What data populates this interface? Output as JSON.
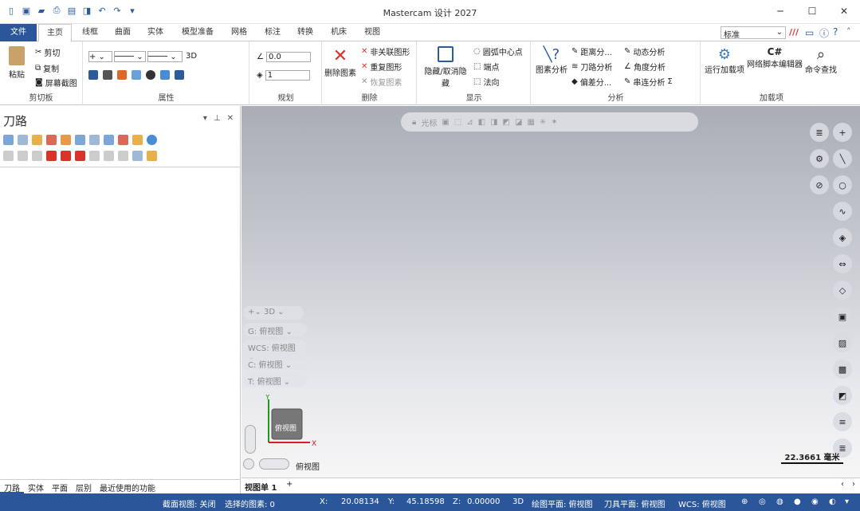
{
  "title": "Mastercam 设计 2027",
  "tabs": [
    "文件",
    "主页",
    "线框",
    "曲面",
    "实体",
    "模型准备",
    "网格",
    "标注",
    "转换",
    "机床",
    "视图"
  ],
  "search": {
    "value": "标准"
  },
  "ribbon": {
    "clipboard": {
      "paste": "粘贴",
      "cut": "剪切",
      "copy": "复制",
      "screenshot": "屏幕截图",
      "label": "剪切板"
    },
    "attributes": {
      "label": "属性",
      "mode": "3D"
    },
    "planning": {
      "label": "规划",
      "z": "0.0",
      "level": "1"
    },
    "delete": {
      "big": "删除图素",
      "nonassoc": "非关联图形",
      "duplicate": "重复图形",
      "restore": "恢复图素",
      "label": "删除"
    },
    "display": {
      "hide": "隐藏/取消隐藏",
      "arc_center": "圆弧中心点",
      "endpoint": "端点",
      "normal": "法向",
      "label": "显示"
    },
    "analysis": {
      "entity": "图素分析",
      "distance": "距离分...",
      "toolpath": "刀路分析",
      "deviation": "偏差分...",
      "dynamic": "动态分析",
      "angle": "角度分析",
      "check": "串连分析",
      "label": "分析"
    },
    "addins": {
      "run": "运行加载项",
      "script": "网络脚本编辑器",
      "cmd": "命令查找",
      "label": "加载项"
    }
  },
  "panel": {
    "title": "刀路",
    "tabs": [
      "刀路",
      "实体",
      "平面",
      "层别",
      "最近使用的功能"
    ]
  },
  "viewport": {
    "toolbar_label": "光标",
    "view_3d": "3D",
    "planes": [
      {
        "k": "G:",
        "v": "俯视图"
      },
      {
        "k": "WCS:",
        "v": "俯视图"
      },
      {
        "k": "C:",
        "v": "俯视图"
      },
      {
        "k": "T:",
        "v": "俯视图"
      }
    ],
    "axis_label": "俯视图",
    "view_name": "俯视图",
    "scale": "22.3661 毫米"
  },
  "sheet": {
    "tab": "视图单 1"
  },
  "status": {
    "section": "截面视图: 关闭",
    "selected": "选择的图素: 0",
    "x_label": "X:",
    "x": "20.08134",
    "y_label": "Y:",
    "y": "45.18598",
    "z_label": "Z:",
    "z": "0.00000",
    "mode": "3D",
    "gplane": "绘图平面: 俯视图",
    "tplane": "刀具平面: 俯视图",
    "wcs": "WCS: 俯视图"
  }
}
